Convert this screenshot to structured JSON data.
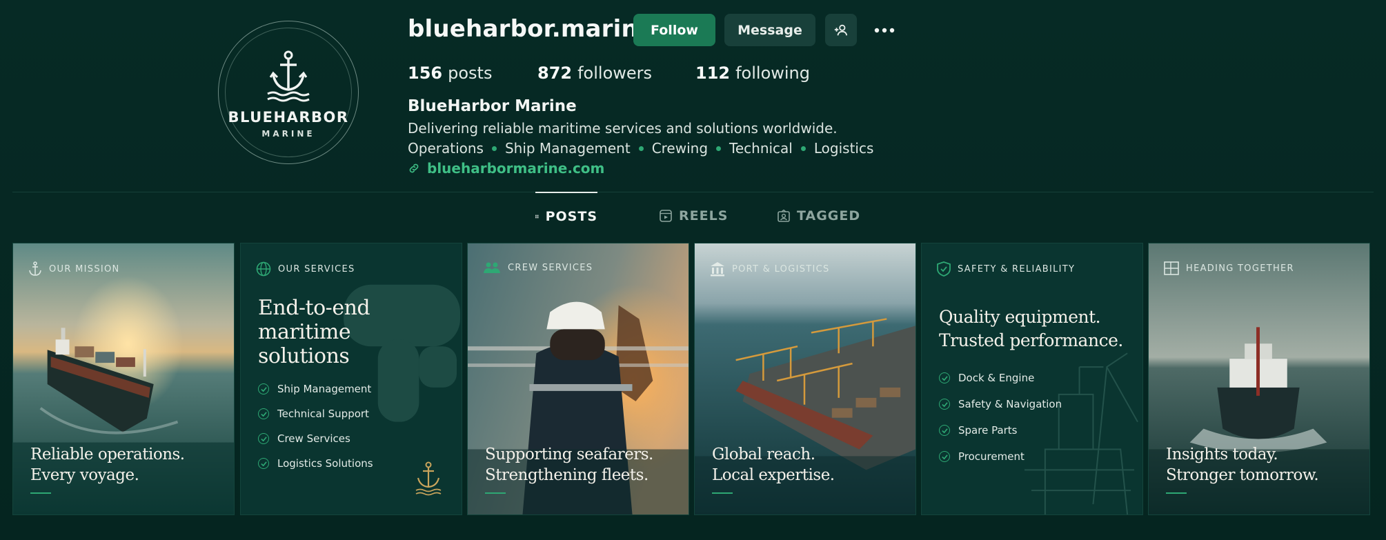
{
  "profile": {
    "avatar": {
      "brand": "BLUEHARBOR",
      "sub": "MARINE"
    },
    "username": "blueharbor.marine",
    "follow_label": "Follow",
    "message_label": "Message",
    "stats": {
      "posts_count": "156",
      "posts_label": "posts",
      "followers_count": "872",
      "followers_label": "followers",
      "following_count": "112",
      "following_label": "following"
    },
    "bio": {
      "name": "BlueHarbor Marine",
      "description": "Delivering reliable maritime services and solutions worldwide.",
      "tags": [
        "Operations",
        "Ship Management",
        "Crewing",
        "Technical",
        "Logistics"
      ],
      "link": "blueharbormarine.com"
    }
  },
  "tabs": [
    {
      "label": "POSTS",
      "icon": "grid-icon",
      "active": true
    },
    {
      "label": "REELS",
      "icon": "reels-icon",
      "active": false
    },
    {
      "label": "TAGGED",
      "icon": "tagged-icon",
      "active": false
    }
  ],
  "posts": [
    {
      "label": "OUR MISSION",
      "icon": "anchor-icon",
      "caption_1": "Reliable operations.",
      "caption_2": "Every voyage."
    },
    {
      "label": "OUR SERVICES",
      "icon": "globe-icon",
      "heading_1": "End-to-end",
      "heading_2": "maritime",
      "heading_3": "solutions",
      "items": [
        "Ship Management",
        "Technical Support",
        "Crew Services",
        "Logistics Solutions"
      ]
    },
    {
      "label": "CREW SERVICES",
      "icon": "people-icon",
      "caption_1": "Supporting seafarers.",
      "caption_2": "Strengthening fleets."
    },
    {
      "label": "PORT & LOGISTICS",
      "icon": "building-icon",
      "caption_1": "Global reach.",
      "caption_2": "Local expertise."
    },
    {
      "label": "SAFETY & RELIABILITY",
      "icon": "shield-icon",
      "heading_1": "Quality equipment.",
      "heading_2": "Trusted performance.",
      "items": [
        "Dock & Engine",
        "Safety & Navigation",
        "Spare Parts",
        "Procurement"
      ]
    },
    {
      "label": "HEADING TOGETHER",
      "icon": "layout-icon",
      "caption_1": "Insights today.",
      "caption_2": "Stronger tomorrow."
    }
  ],
  "colors": {
    "accent": "#1b7a55",
    "link": "#3fbf86",
    "background": "#062a25",
    "gold": "#c9a45c"
  }
}
